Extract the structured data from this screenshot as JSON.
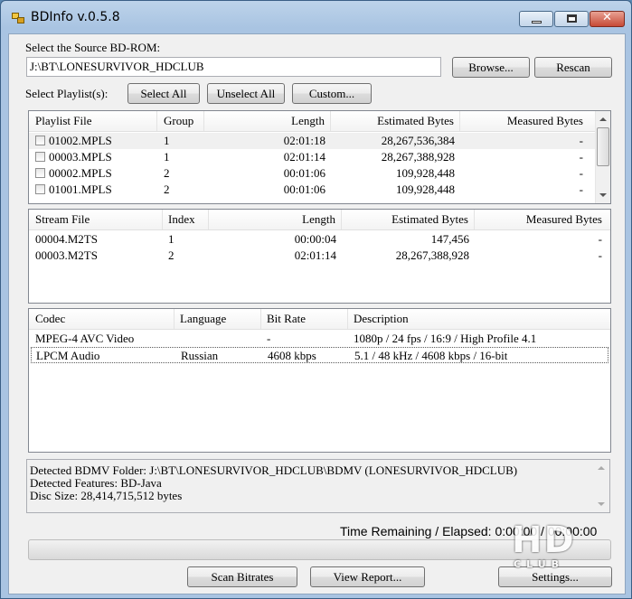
{
  "window": {
    "title": "BDInfo v.0.5.8",
    "app_icon": "app-icon",
    "controls": [
      "minimize-icon",
      "maximize-icon",
      "close-icon"
    ]
  },
  "source": {
    "label": "Select the Source BD-ROM:",
    "path": "J:\\BT\\LONESURVIVOR_HDCLUB",
    "browse_label": "Browse...",
    "rescan_label": "Rescan"
  },
  "playlist_bar": {
    "label": "Select Playlist(s):",
    "select_all_label": "Select All",
    "unselect_all_label": "Unselect All",
    "custom_label": "Custom..."
  },
  "playlists": {
    "columns": [
      "Playlist File",
      "Group",
      "Length",
      "Estimated Bytes",
      "Measured Bytes"
    ],
    "rows": [
      {
        "file": "01002.MPLS",
        "group": "1",
        "length": "02:01:18",
        "estimated": "28,267,536,384",
        "measured": "-"
      },
      {
        "file": "00003.MPLS",
        "group": "1",
        "length": "02:01:14",
        "estimated": "28,267,388,928",
        "measured": "-"
      },
      {
        "file": "00002.MPLS",
        "group": "2",
        "length": "00:01:06",
        "estimated": "109,928,448",
        "measured": "-"
      },
      {
        "file": "01001.MPLS",
        "group": "2",
        "length": "00:01:06",
        "estimated": "109,928,448",
        "measured": "-"
      }
    ]
  },
  "streams": {
    "columns": [
      "Stream File",
      "Index",
      "Length",
      "Estimated Bytes",
      "Measured Bytes"
    ],
    "rows": [
      {
        "file": "00004.M2TS",
        "index": "1",
        "length": "00:00:04",
        "estimated": "147,456",
        "measured": "-"
      },
      {
        "file": "00003.M2TS",
        "index": "2",
        "length": "02:01:14",
        "estimated": "28,267,388,928",
        "measured": "-"
      }
    ]
  },
  "codecs": {
    "columns": [
      "Codec",
      "Language",
      "Bit Rate",
      "Description"
    ],
    "rows": [
      {
        "codec": "MPEG-4 AVC Video",
        "language": "",
        "bitrate": "-",
        "description": "1080p / 24 fps / 16:9 / High Profile 4.1"
      },
      {
        "codec": "LPCM Audio",
        "language": "Russian",
        "bitrate": "4608 kbps",
        "description": "5.1 / 48 kHz / 4608 kbps / 16-bit"
      }
    ]
  },
  "info": {
    "lines": [
      "Detected BDMV Folder: J:\\BT\\LONESURVIVOR_HDCLUB\\BDMV (LONESURVIVOR_HDCLUB)",
      "Detected Features: BD-Java",
      "Disc Size: 28,414,715,512 bytes"
    ]
  },
  "status": {
    "time_label": "Time Remaining / Elapsed:",
    "time_values": "0:00:00 / 00:00:00",
    "progress_fraction": 0
  },
  "bottom": {
    "scan_label": "Scan Bitrates",
    "report_label": "View Report...",
    "settings_label": "Settings..."
  },
  "watermark": {
    "text": "HD",
    "subtext": "CLUB"
  },
  "colors": {
    "title_bar": "#a9c4e2",
    "selected_row_border": "#5a5a5a",
    "window_bg": "#f0f0f0"
  }
}
